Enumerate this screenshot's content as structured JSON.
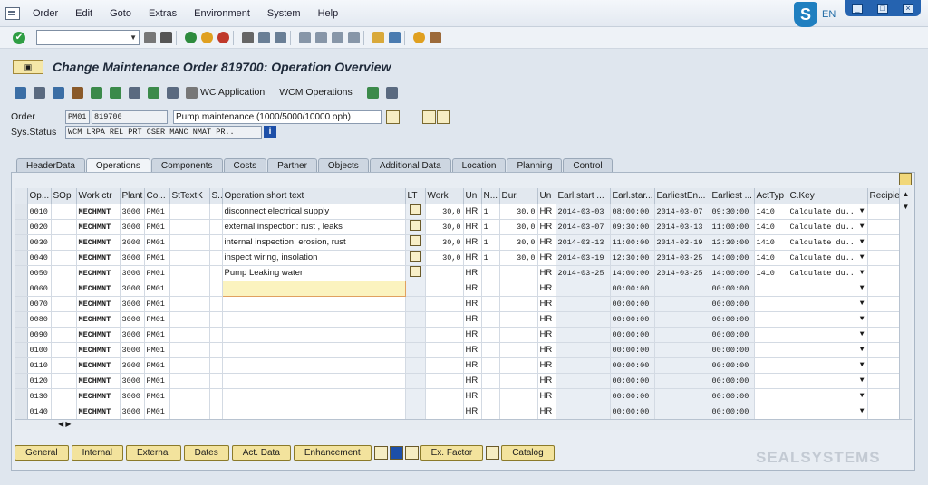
{
  "menu": [
    "Order",
    "Edit",
    "Goto",
    "Extras",
    "Environment",
    "System",
    "Help"
  ],
  "lang": "EN",
  "title": "Change Maintenance Order 819700: Operation Overview",
  "toolbar2": {
    "wc_application": "WC Application",
    "wcm_operations": "WCM Operations"
  },
  "header": {
    "order_label": "Order",
    "order_type": "PM01",
    "order_number": "819700",
    "order_desc": "Pump maintenance (1000/5000/10000 oph)",
    "status_label": "Sys.Status",
    "status_value": "WCM  LRPA REL  PRT  CSER MANC NMAT PR.."
  },
  "tabs": [
    "HeaderData",
    "Operations",
    "Components",
    "Costs",
    "Partner",
    "Objects",
    "Additional Data",
    "Location",
    "Planning",
    "Control"
  ],
  "columns": [
    "Op...",
    "SOp",
    "Work ctr",
    "Plant",
    "Co...",
    "StTextK",
    "S..",
    "Operation short text",
    "LT",
    "Work",
    "Un",
    "N...",
    "Dur.",
    "Un",
    "Earl.start ...",
    "Earl.star...",
    "EarliestEn...",
    "Earliest ...",
    "ActTyp",
    "C.Key",
    "Recipie"
  ],
  "rows": [
    {
      "op": "0010",
      "wc": "MECHMNT",
      "plant": "3000",
      "co": "PM01",
      "text": "disconnect electrical supply",
      "work": "30,0",
      "un": "HR",
      "n": "1",
      "dur": "30,0",
      "un2": "HR",
      "es_date": "2014-03-03",
      "es_time": "08:00:00",
      "ee_date": "2014-03-07",
      "ee_time": "09:30:00",
      "act": "1410",
      "ckey": "Calculate du.."
    },
    {
      "op": "0020",
      "wc": "MECHMNT",
      "plant": "3000",
      "co": "PM01",
      "text": "external inspection: rust , leaks",
      "work": "30,0",
      "un": "HR",
      "n": "1",
      "dur": "30,0",
      "un2": "HR",
      "es_date": "2014-03-07",
      "es_time": "09:30:00",
      "ee_date": "2014-03-13",
      "ee_time": "11:00:00",
      "act": "1410",
      "ckey": "Calculate du.."
    },
    {
      "op": "0030",
      "wc": "MECHMNT",
      "plant": "3000",
      "co": "PM01",
      "text": "internal inspection: erosion, rust",
      "work": "30,0",
      "un": "HR",
      "n": "1",
      "dur": "30,0",
      "un2": "HR",
      "es_date": "2014-03-13",
      "es_time": "11:00:00",
      "ee_date": "2014-03-19",
      "ee_time": "12:30:00",
      "act": "1410",
      "ckey": "Calculate du.."
    },
    {
      "op": "0040",
      "wc": "MECHMNT",
      "plant": "3000",
      "co": "PM01",
      "text": "inspect wiring, insolation",
      "work": "30,0",
      "un": "HR",
      "n": "1",
      "dur": "30,0",
      "un2": "HR",
      "es_date": "2014-03-19",
      "es_time": "12:30:00",
      "ee_date": "2014-03-25",
      "ee_time": "14:00:00",
      "act": "1410",
      "ckey": "Calculate du.."
    },
    {
      "op": "0050",
      "wc": "MECHMNT",
      "plant": "3000",
      "co": "PM01",
      "text": "Pump Leaking water",
      "work": "",
      "un": "HR",
      "n": "",
      "dur": "",
      "un2": "HR",
      "es_date": "2014-03-25",
      "es_time": "14:00:00",
      "ee_date": "2014-03-25",
      "ee_time": "14:00:00",
      "act": "1410",
      "ckey": "Calculate du.."
    },
    {
      "op": "0060",
      "wc": "MECHMNT",
      "plant": "3000",
      "co": "PM01",
      "text": "",
      "work": "",
      "un": "HR",
      "n": "",
      "dur": "",
      "un2": "HR",
      "es_date": "",
      "es_time": "00:00:00",
      "ee_date": "",
      "ee_time": "00:00:00",
      "act": "",
      "ckey": ""
    },
    {
      "op": "0070",
      "wc": "MECHMNT",
      "plant": "3000",
      "co": "PM01",
      "text": "",
      "work": "",
      "un": "HR",
      "n": "",
      "dur": "",
      "un2": "HR",
      "es_date": "",
      "es_time": "00:00:00",
      "ee_date": "",
      "ee_time": "00:00:00",
      "act": "",
      "ckey": ""
    },
    {
      "op": "0080",
      "wc": "MECHMNT",
      "plant": "3000",
      "co": "PM01",
      "text": "",
      "work": "",
      "un": "HR",
      "n": "",
      "dur": "",
      "un2": "HR",
      "es_date": "",
      "es_time": "00:00:00",
      "ee_date": "",
      "ee_time": "00:00:00",
      "act": "",
      "ckey": ""
    },
    {
      "op": "0090",
      "wc": "MECHMNT",
      "plant": "3000",
      "co": "PM01",
      "text": "",
      "work": "",
      "un": "HR",
      "n": "",
      "dur": "",
      "un2": "HR",
      "es_date": "",
      "es_time": "00:00:00",
      "ee_date": "",
      "ee_time": "00:00:00",
      "act": "",
      "ckey": ""
    },
    {
      "op": "0100",
      "wc": "MECHMNT",
      "plant": "3000",
      "co": "PM01",
      "text": "",
      "work": "",
      "un": "HR",
      "n": "",
      "dur": "",
      "un2": "HR",
      "es_date": "",
      "es_time": "00:00:00",
      "ee_date": "",
      "ee_time": "00:00:00",
      "act": "",
      "ckey": ""
    },
    {
      "op": "0110",
      "wc": "MECHMNT",
      "plant": "3000",
      "co": "PM01",
      "text": "",
      "work": "",
      "un": "HR",
      "n": "",
      "dur": "",
      "un2": "HR",
      "es_date": "",
      "es_time": "00:00:00",
      "ee_date": "",
      "ee_time": "00:00:00",
      "act": "",
      "ckey": ""
    },
    {
      "op": "0120",
      "wc": "MECHMNT",
      "plant": "3000",
      "co": "PM01",
      "text": "",
      "work": "",
      "un": "HR",
      "n": "",
      "dur": "",
      "un2": "HR",
      "es_date": "",
      "es_time": "00:00:00",
      "ee_date": "",
      "ee_time": "00:00:00",
      "act": "",
      "ckey": ""
    },
    {
      "op": "0130",
      "wc": "MECHMNT",
      "plant": "3000",
      "co": "PM01",
      "text": "",
      "work": "",
      "un": "HR",
      "n": "",
      "dur": "",
      "un2": "HR",
      "es_date": "",
      "es_time": "00:00:00",
      "ee_date": "",
      "ee_time": "00:00:00",
      "act": "",
      "ckey": ""
    },
    {
      "op": "0140",
      "wc": "MECHMNT",
      "plant": "3000",
      "co": "PM01",
      "text": "",
      "work": "",
      "un": "HR",
      "n": "",
      "dur": "",
      "un2": "HR",
      "es_date": "",
      "es_time": "00:00:00",
      "ee_date": "",
      "ee_time": "00:00:00",
      "act": "",
      "ckey": ""
    }
  ],
  "bottom_buttons": [
    "General",
    "Internal",
    "External",
    "Dates",
    "Act. Data",
    "Enhancement",
    "Ex. Factor",
    "Catalog"
  ],
  "watermark": "SEALSYSTEMS"
}
